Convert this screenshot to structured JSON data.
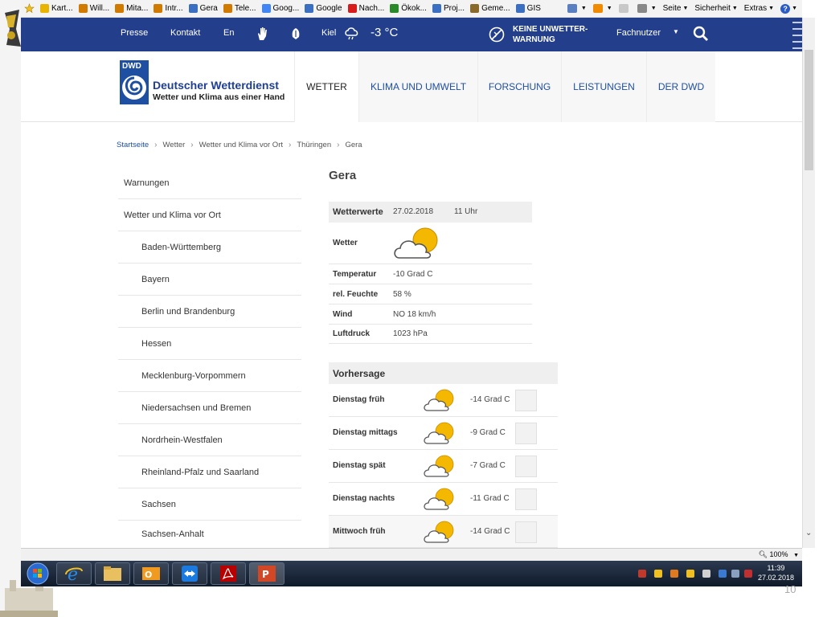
{
  "favorites": [
    {
      "label": "Kart...",
      "color": "#e8b400"
    },
    {
      "label": "Will...",
      "color": "#d07a00"
    },
    {
      "label": "Mita...",
      "color": "#d07a00"
    },
    {
      "label": "Intr...",
      "color": "#d07a00"
    },
    {
      "label": "Gera",
      "color": "#3a6fc2"
    },
    {
      "label": "Tele...",
      "color": "#d07a00"
    },
    {
      "label": "Goog...",
      "color": "#4285f4"
    },
    {
      "label": "Google",
      "color": "#3a6fc2"
    },
    {
      "label": "Nach...",
      "color": "#d81c1c"
    },
    {
      "label": "Ökok...",
      "color": "#2a8a2a"
    },
    {
      "label": "Proj...",
      "color": "#3a6fc2"
    },
    {
      "label": "Geme...",
      "color": "#8a6a2a"
    },
    {
      "label": "GIS",
      "color": "#3a6fc2"
    }
  ],
  "ie_tools": {
    "page": "Seite",
    "safety": "Sicherheit",
    "extras": "Extras",
    "help": "?"
  },
  "topbar": {
    "press": "Presse",
    "contact": "Kontakt",
    "lang": "En",
    "city": "Kiel",
    "temp": "-3 °C",
    "warning": "KEINE UNWETTER-WARNUNG",
    "fachnutzer": "Fachnutzer"
  },
  "brand": {
    "logo_text": "DWD",
    "name": "Deutscher Wetterdienst",
    "tagline": "Wetter und Klima aus einer Hand"
  },
  "nav": [
    "WETTER",
    "KLIMA UND UMWELT",
    "FORSCHUNG",
    "LEISTUNGEN",
    "DER DWD"
  ],
  "breadcrumb": [
    "Startseite",
    "Wetter",
    "Wetter und Klima vor Ort",
    "Thüringen",
    "Gera"
  ],
  "sidebar": [
    {
      "label": "Warnungen",
      "level": 0
    },
    {
      "label": "Wetter und Klima vor Ort",
      "level": 0
    },
    {
      "label": "Baden-Württemberg",
      "level": 1
    },
    {
      "label": "Bayern",
      "level": 1
    },
    {
      "label": "Berlin und Brandenburg",
      "level": 1
    },
    {
      "label": "Hessen",
      "level": 1
    },
    {
      "label": "Mecklenburg-Vorpommern",
      "level": 1
    },
    {
      "label": "Niedersachsen und Bremen",
      "level": 1
    },
    {
      "label": "Nordrhein-Westfalen",
      "level": 1
    },
    {
      "label": "Rheinland-Pfalz und Saarland",
      "level": 1
    },
    {
      "label": "Sachsen",
      "level": 1
    },
    {
      "label": "Sachsen-Anhalt",
      "level": 1
    }
  ],
  "main": {
    "city": "Gera",
    "werte_head": {
      "label": "Wetterwerte",
      "date": "27.02.2018",
      "time": "11 Uhr"
    },
    "weather_label": "Wetter",
    "values": [
      {
        "label": "Temperatur",
        "value": "-10 Grad C"
      },
      {
        "label": "rel. Feuchte",
        "value": "58 %"
      },
      {
        "label": "Wind",
        "value": "NO 18 km/h"
      },
      {
        "label": "Luftdruck",
        "value": "1023 hPa"
      }
    ],
    "forecast_head": "Vorhersage",
    "forecast": [
      {
        "label": "Dienstag früh",
        "temp": "-14 Grad C"
      },
      {
        "label": "Dienstag mittags",
        "temp": "-9 Grad C"
      },
      {
        "label": "Dienstag spät",
        "temp": "-7 Grad C"
      },
      {
        "label": "Dienstag nachts",
        "temp": "-11 Grad C"
      },
      {
        "label": "Mittwoch früh",
        "temp": "-14 Grad C"
      }
    ]
  },
  "statusbar": {
    "zoom": "100%"
  },
  "clock": {
    "time": "11:39",
    "date": "27.02.2018"
  },
  "slide_number": "10"
}
